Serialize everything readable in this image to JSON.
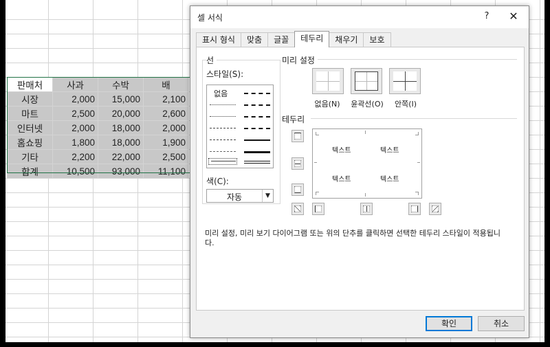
{
  "sheet": {
    "headers": [
      "판매처",
      "사과",
      "수박",
      "배"
    ],
    "rows": [
      {
        "name": "시장",
        "values": [
          "2,000",
          "15,000",
          "2,100"
        ]
      },
      {
        "name": "마트",
        "values": [
          "2,500",
          "20,000",
          "2,600"
        ]
      },
      {
        "name": "인터넷",
        "values": [
          "2,000",
          "18,000",
          "2,000"
        ]
      },
      {
        "name": "홈쇼핑",
        "values": [
          "1,800",
          "18,000",
          "1,900"
        ]
      },
      {
        "name": "기타",
        "values": [
          "2,200",
          "22,000",
          "2,500"
        ]
      },
      {
        "name": "합계",
        "values": [
          "10,500",
          "93,000",
          "11,100"
        ]
      }
    ]
  },
  "dialog": {
    "title": "셀 서식",
    "help": "?",
    "close": "✕",
    "tabs": [
      "표시 형식",
      "맞춤",
      "글꼴",
      "테두리",
      "채우기",
      "보호"
    ],
    "active_tab": "테두리",
    "line": {
      "group_label": "선",
      "style_label": "스타일(S):",
      "none_label": "없음",
      "color_label": "색(C):",
      "color_value": "자동"
    },
    "presets": {
      "group_label": "미리 설정",
      "items": [
        "없음(N)",
        "윤곽선(O)",
        "안쪽(I)"
      ]
    },
    "border": {
      "group_label": "테두리",
      "preview_text": [
        "텍스트",
        "텍스트",
        "텍스트",
        "텍스트"
      ]
    },
    "description": "미리 설정, 미리 보기 다이어그램 또는 위의 단추를 클릭하면 선택한 테두리 스타일이 적용됩니다.",
    "ok": "확인",
    "cancel": "취소"
  },
  "colors": {
    "selection_border": "#217346",
    "selected_fill": "#c8c8c8",
    "accent": "#0078d7"
  }
}
